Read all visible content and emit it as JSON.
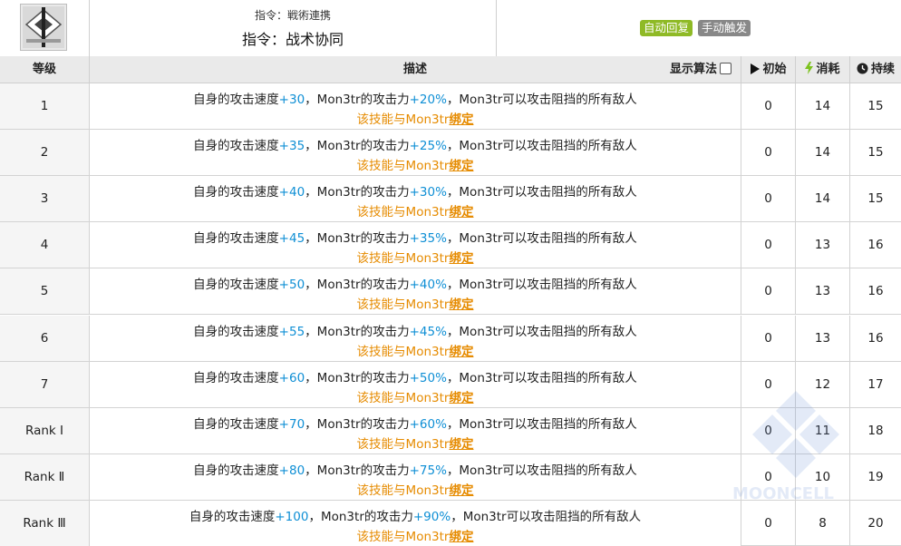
{
  "skill": {
    "name_original": "指令：戦術連携",
    "name_cn": "指令：战术协同",
    "icon": "skill-tactical-icon",
    "tags": [
      {
        "label": "自动回复",
        "color": "#8fba26"
      },
      {
        "label": "手动触发",
        "color": "#888888"
      }
    ]
  },
  "table": {
    "headers": {
      "level": "等级",
      "description": "描述",
      "show_formula": "显示算法",
      "initial": "初始",
      "cost": "消耗",
      "duration": "持续"
    },
    "header_icons": {
      "initial": "play-icon",
      "cost": "lightning-icon",
      "duration": "clock-icon"
    },
    "rows": [
      {
        "level": "1",
        "p1": "自身的攻击速度",
        "v1": "+30",
        "p2": "，Mon3tr的攻击力",
        "v2": "+20%",
        "p3": "，Mon3tr可以攻击阻挡的所有敌人",
        "note_prefix": "该技能与Mon3tr",
        "note_link": "绑定",
        "initial": "0",
        "cost": "14",
        "duration": "15"
      },
      {
        "level": "2",
        "p1": "自身的攻击速度",
        "v1": "+35",
        "p2": "，Mon3tr的攻击力",
        "v2": "+25%",
        "p3": "，Mon3tr可以攻击阻挡的所有敌人",
        "note_prefix": "该技能与Mon3tr",
        "note_link": "绑定",
        "initial": "0",
        "cost": "14",
        "duration": "15"
      },
      {
        "level": "3",
        "p1": "自身的攻击速度",
        "v1": "+40",
        "p2": "，Mon3tr的攻击力",
        "v2": "+30%",
        "p3": "，Mon3tr可以攻击阻挡的所有敌人",
        "note_prefix": "该技能与Mon3tr",
        "note_link": "绑定",
        "initial": "0",
        "cost": "14",
        "duration": "15"
      },
      {
        "level": "4",
        "p1": "自身的攻击速度",
        "v1": "+45",
        "p2": "，Mon3tr的攻击力",
        "v2": "+35%",
        "p3": "，Mon3tr可以攻击阻挡的所有敌人",
        "note_prefix": "该技能与Mon3tr",
        "note_link": "绑定",
        "initial": "0",
        "cost": "13",
        "duration": "16"
      },
      {
        "level": "5",
        "p1": "自身的攻击速度",
        "v1": "+50",
        "p2": "，Mon3tr的攻击力",
        "v2": "+40%",
        "p3": "，Mon3tr可以攻击阻挡的所有敌人",
        "note_prefix": "该技能与Mon3tr",
        "note_link": "绑定",
        "initial": "0",
        "cost": "13",
        "duration": "16"
      },
      {
        "level": "6",
        "p1": "自身的攻击速度",
        "v1": "+55",
        "p2": "，Mon3tr的攻击力",
        "v2": "+45%",
        "p3": "，Mon3tr可以攻击阻挡的所有敌人",
        "note_prefix": "该技能与Mon3tr",
        "note_link": "绑定",
        "initial": "0",
        "cost": "13",
        "duration": "16"
      },
      {
        "level": "7",
        "p1": "自身的攻击速度",
        "v1": "+60",
        "p2": "，Mon3tr的攻击力",
        "v2": "+50%",
        "p3": "，Mon3tr可以攻击阻挡的所有敌人",
        "note_prefix": "该技能与Mon3tr",
        "note_link": "绑定",
        "initial": "0",
        "cost": "12",
        "duration": "17"
      },
      {
        "level": "Rank Ⅰ",
        "p1": "自身的攻击速度",
        "v1": "+70",
        "p2": "，Mon3tr的攻击力",
        "v2": "+60%",
        "p3": "，Mon3tr可以攻击阻挡的所有敌人",
        "note_prefix": "该技能与Mon3tr",
        "note_link": "绑定",
        "initial": "0",
        "cost": "11",
        "duration": "18"
      },
      {
        "level": "Rank Ⅱ",
        "p1": "自身的攻击速度",
        "v1": "+80",
        "p2": "，Mon3tr的攻击力",
        "v2": "+75%",
        "p3": "，Mon3tr可以攻击阻挡的所有敌人",
        "note_prefix": "该技能与Mon3tr",
        "note_link": "绑定",
        "initial": "0",
        "cost": "10",
        "duration": "19"
      },
      {
        "level": "Rank Ⅲ",
        "p1": "自身的攻击速度",
        "v1": "+100",
        "p2": "，Mon3tr的攻击力",
        "v2": "+90%",
        "p3": "，Mon3tr可以攻击阻挡的所有敌人",
        "note_prefix": "该技能与Mon3tr",
        "note_link": "绑定",
        "initial": "0",
        "cost": "8",
        "duration": "20"
      }
    ]
  },
  "watermark": {
    "text": "MOONCELL"
  },
  "colors": {
    "value_highlight": "#0f8fd5",
    "note": "#e68b00",
    "header_bg": "#eaeaea"
  }
}
